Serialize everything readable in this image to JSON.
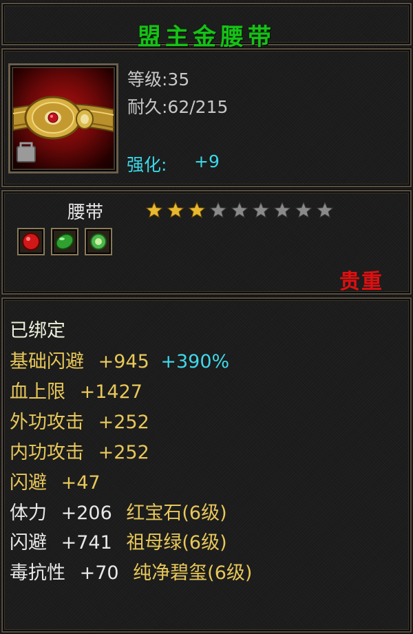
{
  "item": {
    "name": "盟主金腰带",
    "level_label": "等级:35",
    "durability_label": "耐久:62/215",
    "enhance_label": "强化:",
    "enhance_value": "+9",
    "category": "腰带",
    "stars_filled": 3,
    "stars_total": 9,
    "rarity": "贵重"
  },
  "gem_slots": [
    {
      "name": "red-gem-icon",
      "color": "#d01818"
    },
    {
      "name": "green-gem-icon",
      "color": "#30a030"
    },
    {
      "name": "jade-gem-icon",
      "color": "#4cb84c"
    }
  ],
  "stats": {
    "bound": "已绑定",
    "rows": [
      {
        "label": "基础闪避",
        "value": "+945",
        "extra": "+390%"
      },
      {
        "label": "血上限",
        "value": "+1427"
      },
      {
        "label": "外功攻击",
        "value": "+252"
      },
      {
        "label": "内功攻击",
        "value": "+252"
      },
      {
        "label": "闪避",
        "value": "+47"
      }
    ],
    "gem_rows": [
      {
        "label": "体力",
        "value": "+206",
        "gem": "红宝石(6级)"
      },
      {
        "label": "闪避",
        "value": "+741",
        "gem": "祖母绿(6级)"
      },
      {
        "label": "毒抗性",
        "value": "+70",
        "gem": "纯净碧玺(6级)"
      }
    ]
  },
  "colors": {
    "title_green": "#18c018",
    "rarity_red": "#e01010",
    "stat_gold": "#e8c85a",
    "stat_cyan": "#40d8e8",
    "star_gold": "#e8b830",
    "star_empty": "#8a8a8a"
  }
}
